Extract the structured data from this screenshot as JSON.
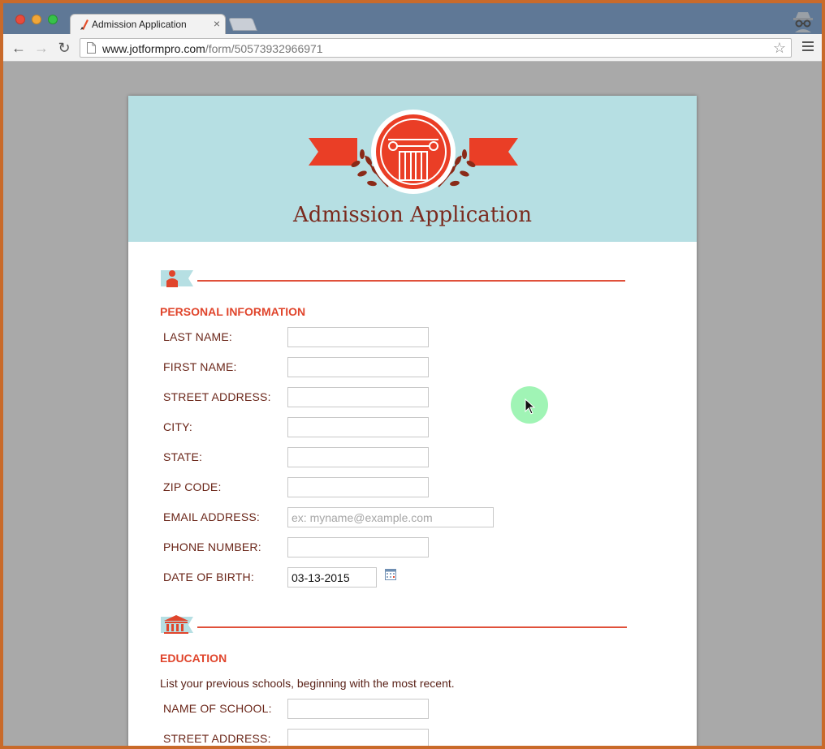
{
  "browser": {
    "tab_title": "Admission Application",
    "tab_close": "×",
    "url_host": "www.jotformpro.com",
    "url_path": "/form/50573932966971",
    "back_glyph": "←",
    "forward_glyph": "→",
    "reload_glyph": "↻",
    "star_glyph": "☆"
  },
  "form": {
    "title": "Admission Application",
    "sections": {
      "personal": {
        "title": "PERSONAL INFORMATION",
        "icon": "person-icon",
        "fields": {
          "last_name": {
            "label": "LAST NAME:",
            "value": ""
          },
          "first_name": {
            "label": "FIRST NAME:",
            "value": ""
          },
          "street_address": {
            "label": "STREET ADDRESS:",
            "value": ""
          },
          "city": {
            "label": "CITY:",
            "value": ""
          },
          "state": {
            "label": "STATE:",
            "value": ""
          },
          "zip_code": {
            "label": "ZIP CODE:",
            "value": ""
          },
          "email": {
            "label": "EMAIL ADDRESS:",
            "value": "",
            "placeholder": "ex: myname@example.com"
          },
          "phone": {
            "label": "PHONE NUMBER:",
            "value": ""
          },
          "dob": {
            "label": "DATE OF BIRTH:",
            "value": "03-13-2015",
            "icon": "calendar-icon"
          }
        }
      },
      "education": {
        "title": "EDUCATION",
        "icon": "school-building-icon",
        "description": "List your previous schools, beginning with the most recent.",
        "fields": {
          "school_name": {
            "label": "NAME OF SCHOOL:",
            "value": ""
          },
          "school_street": {
            "label": "STREET ADDRESS:",
            "value": ""
          }
        }
      }
    }
  },
  "colors": {
    "accent": "#e0503a",
    "label": "#6a2518",
    "header_bg": "#b6dfe3",
    "title": "#7a2a1e",
    "chrome_bar": "#5f7896"
  }
}
